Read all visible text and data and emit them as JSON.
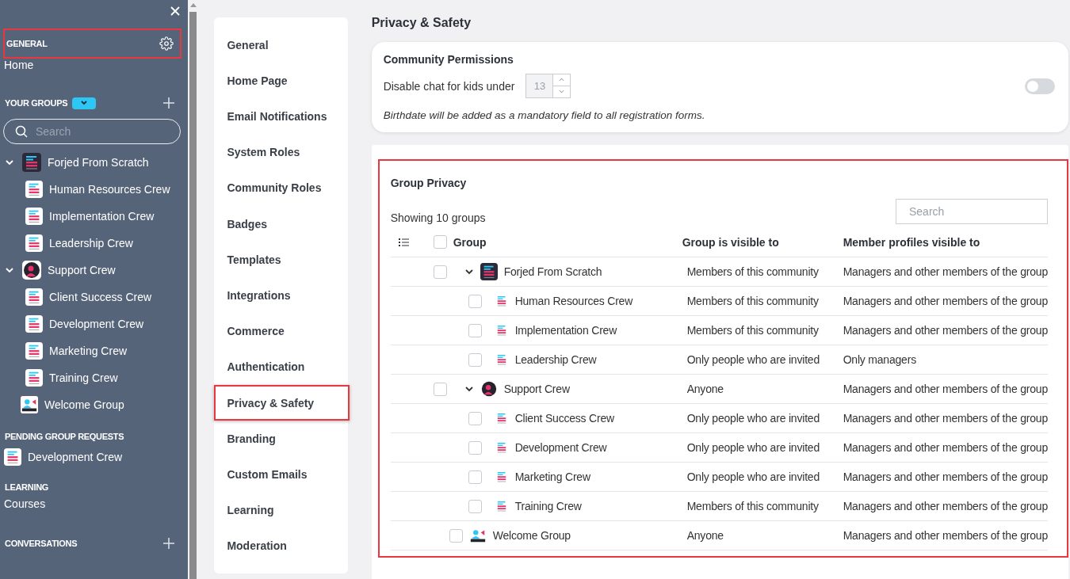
{
  "sidebar": {
    "general": {
      "label": "GENERAL",
      "highlighted": true
    },
    "home": "Home",
    "your_groups": "YOUR GROUPS",
    "search_placeholder": "Search",
    "groups": [
      {
        "name": "Forjed From Scratch",
        "kind": "dark",
        "expanded": true,
        "children": [
          {
            "name": "Human Resources Crew",
            "kind": "logo"
          },
          {
            "name": "Implementation Crew",
            "kind": "logo"
          },
          {
            "name": "Leadership Crew",
            "kind": "logo"
          }
        ]
      },
      {
        "name": "Support Crew",
        "kind": "avatar",
        "expanded": true,
        "children": [
          {
            "name": "Client Success Crew",
            "kind": "logo"
          },
          {
            "name": "Development Crew",
            "kind": "logo"
          },
          {
            "name": "Marketing Crew",
            "kind": "logo"
          },
          {
            "name": "Training Crew",
            "kind": "logo"
          }
        ]
      },
      {
        "name": "Welcome Group",
        "kind": "video"
      }
    ],
    "pending": {
      "label": "PENDING GROUP REQUESTS",
      "items": [
        {
          "name": "Development Crew",
          "kind": "logo"
        }
      ]
    },
    "learning": {
      "label": "LEARNING",
      "items": [
        "Courses"
      ]
    },
    "conversations": "CONVERSATIONS"
  },
  "nav": {
    "items": [
      {
        "label": "General",
        "selected": false
      },
      {
        "label": "Home Page",
        "selected": false
      },
      {
        "label": "Email Notifications",
        "selected": false
      },
      {
        "label": "System Roles",
        "selected": false
      },
      {
        "label": "Community Roles",
        "selected": false
      },
      {
        "label": "Badges",
        "selected": false
      },
      {
        "label": "Templates",
        "selected": false
      },
      {
        "label": "Integrations",
        "selected": false
      },
      {
        "label": "Commerce",
        "selected": false
      },
      {
        "label": "Authentication",
        "selected": false
      },
      {
        "label": "Privacy & Safety",
        "selected": true
      },
      {
        "label": "Branding",
        "selected": false
      },
      {
        "label": "Custom Emails",
        "selected": false
      },
      {
        "label": "Learning",
        "selected": false
      },
      {
        "label": "Moderation",
        "selected": false
      }
    ]
  },
  "main": {
    "title": "Privacy & Safety",
    "permissions": {
      "title": "Community Permissions",
      "label": "Disable chat for kids under",
      "age_value": "13",
      "chat_disabled": false,
      "note": "Birthdate will be added as a mandatory field to all registration forms."
    },
    "group_privacy": {
      "highlighted": true,
      "title": "Group Privacy",
      "count": "Showing 10 groups",
      "search_placeholder": "Search",
      "columns": [
        "Group",
        "Group is visible to",
        "Member profiles visible to"
      ],
      "all_checked": false,
      "rows": [
        {
          "name": "Forjed From Scratch",
          "kind": "dark",
          "checked": false,
          "expanded": true,
          "visible": "Members of this community",
          "profiles": "Managers and other members of the group",
          "children": [
            {
              "name": "Human Resources Crew",
              "kind": "logo",
              "checked": false,
              "visible": "Members of this community",
              "profiles": "Managers and other members of the group"
            },
            {
              "name": "Implementation Crew",
              "kind": "logo",
              "checked": false,
              "visible": "Members of this community",
              "profiles": "Managers and other members of the group"
            },
            {
              "name": "Leadership Crew",
              "kind": "logo",
              "checked": false,
              "visible": "Only people who are invited",
              "profiles": "Only managers"
            }
          ]
        },
        {
          "name": "Support Crew",
          "kind": "avatar",
          "checked": false,
          "expanded": true,
          "visible": "Anyone",
          "profiles": "Managers and other members of the group",
          "children": [
            {
              "name": "Client Success Crew",
              "kind": "logo",
              "checked": false,
              "visible": "Only people who are invited",
              "profiles": "Managers and other members of the group"
            },
            {
              "name": "Development Crew",
              "kind": "logo",
              "checked": false,
              "visible": "Only people who are invited",
              "profiles": "Managers and other members of the group"
            },
            {
              "name": "Marketing Crew",
              "kind": "logo",
              "checked": false,
              "visible": "Only people who are invited",
              "profiles": "Managers and other members of the group"
            },
            {
              "name": "Training Crew",
              "kind": "logo",
              "checked": false,
              "visible": "Members of this community",
              "profiles": "Managers and other members of the group"
            }
          ]
        },
        {
          "name": "Welcome Group",
          "kind": "video",
          "checked": false,
          "visible": "Anyone",
          "profiles": "Managers and other members of the group"
        }
      ]
    }
  }
}
